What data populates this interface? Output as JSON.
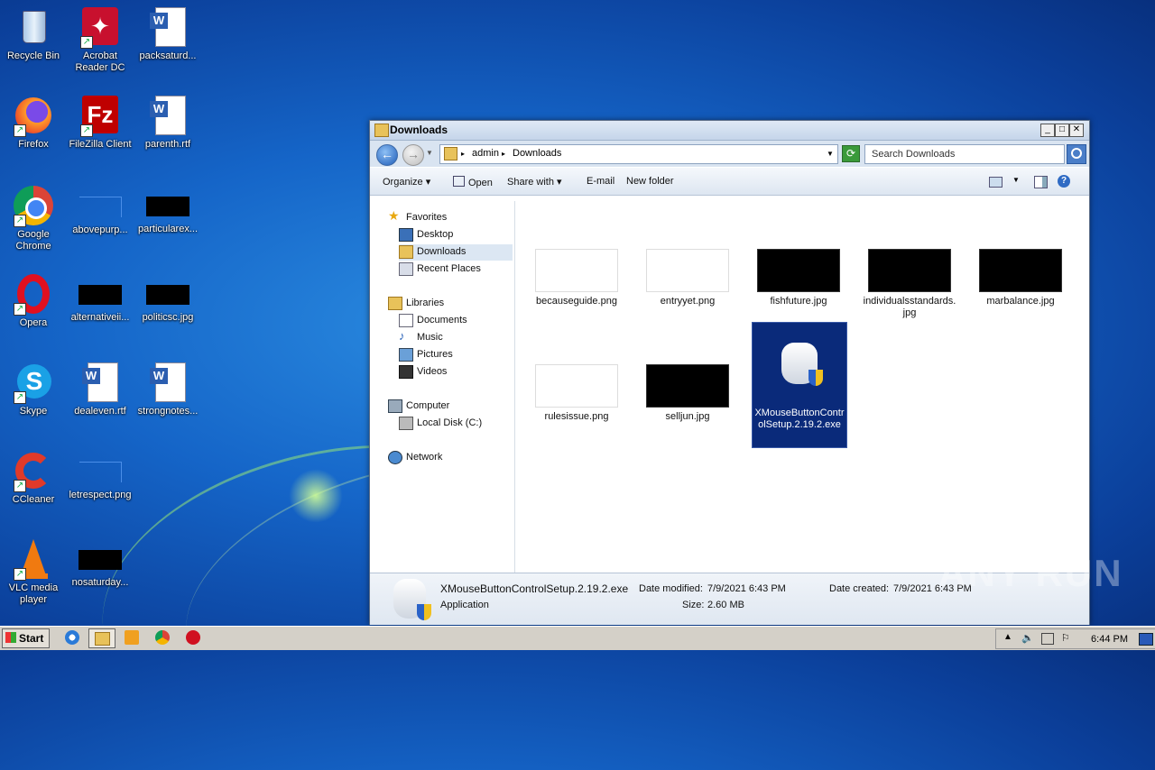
{
  "desktop": {
    "icons": [
      {
        "label": "Recycle Bin"
      },
      {
        "label": "Acrobat\nReader DC"
      },
      {
        "label": "packsaturd..."
      },
      {
        "label": "Firefox"
      },
      {
        "label": "FileZilla Client"
      },
      {
        "label": "parenth.rtf"
      },
      {
        "label": "Google\nChrome"
      },
      {
        "label": "abovepurp..."
      },
      {
        "label": "particularex..."
      },
      {
        "label": "Opera"
      },
      {
        "label": "alternativeii..."
      },
      {
        "label": "politicsc.jpg"
      },
      {
        "label": "Skype"
      },
      {
        "label": "dealeven.rtf"
      },
      {
        "label": "strongnotes..."
      },
      {
        "label": "CCleaner"
      },
      {
        "label": "letrespect.png"
      },
      {
        "label": "VLC media\nplayer"
      },
      {
        "label": "nosaturday..."
      }
    ]
  },
  "window": {
    "title": "Downloads",
    "address": {
      "crumbs": [
        "admin",
        "Downloads"
      ]
    },
    "search_placeholder": "Search Downloads",
    "toolbar": {
      "organize": "Organize",
      "open": "Open",
      "share": "Share with",
      "email": "E-mail",
      "new_folder": "New folder"
    },
    "nav": {
      "favorites": "Favorites",
      "desktop": "Desktop",
      "downloads": "Downloads",
      "recent": "Recent Places",
      "libraries": "Libraries",
      "documents": "Documents",
      "music": "Music",
      "pictures": "Pictures",
      "videos": "Videos",
      "computer": "Computer",
      "local_disk": "Local Disk (C:)",
      "network": "Network"
    },
    "files": [
      {
        "name": "becauseguide.png"
      },
      {
        "name": "entryyet.png"
      },
      {
        "name": "fishfuture.jpg"
      },
      {
        "name": "individualsstandards.jpg"
      },
      {
        "name": "marbalance.jpg"
      },
      {
        "name": "rulesissue.png"
      },
      {
        "name": "selljun.jpg"
      },
      {
        "name": "XMouseButtonControlSetup.2.19.2.exe"
      }
    ],
    "details": {
      "filename": "XMouseButtonControlSetup.2.19.2.exe",
      "type": "Application",
      "modified_label": "Date modified:",
      "modified_value": "7/9/2021 6:43 PM",
      "size_label": "Size:",
      "size_value": "2.60 MB",
      "created_label": "Date created:",
      "created_value": "7/9/2021 6:43 PM"
    }
  },
  "taskbar": {
    "start": "Start",
    "clock": "6:44 PM"
  },
  "watermark": "ANY RUN"
}
